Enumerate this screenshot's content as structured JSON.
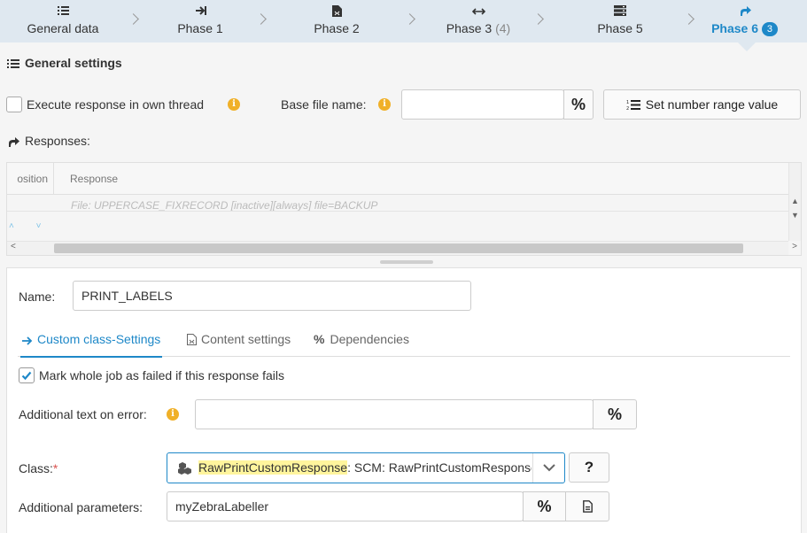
{
  "steps": [
    {
      "label": "General data",
      "icon": "list-icon"
    },
    {
      "label": "Phase 1",
      "icon": "arrow-to-right-icon"
    },
    {
      "label": "Phase 2",
      "icon": "file-code-icon"
    },
    {
      "label": "Phase 3",
      "count": "(4)",
      "icon": "arrows-horizontal-icon"
    },
    {
      "label": "Phase 5",
      "icon": "server-icon"
    },
    {
      "label": "Phase 6",
      "badge": "3",
      "icon": "share-arrow-icon",
      "active": true
    }
  ],
  "general": {
    "title": "General settings",
    "execute_label": "Execute response in own thread",
    "base_file_label": "Base file name:",
    "base_file_value": "",
    "pct_symbol": "%",
    "set_number_range_label": "Set number range value",
    "responses_label": "Responses:"
  },
  "grid": {
    "columns": [
      "osition",
      "Response"
    ],
    "rows": [
      {
        "response": "File: UPPERCASE_FIXRECORD [inactive][always] file=BACKUP"
      }
    ]
  },
  "detail": {
    "name_label": "Name:",
    "name_value": "PRINT_LABELS",
    "tabs": [
      {
        "label_main": "Custom class",
        "label_suffix": "-Settings",
        "active": true
      },
      {
        "label": "Content settings"
      },
      {
        "label": "Dependencies"
      }
    ],
    "mark_failed_label": "Mark whole job as failed if this response fails",
    "mark_failed_checked": true,
    "additional_text_label": "Additional text on error:",
    "additional_text_value": "",
    "class_label": "Class:",
    "class_required": "*",
    "class_highlight": "RawPrintCustomResponse",
    "class_rest": ": SCM: RawPrintCustomResponse",
    "help_symbol": "?",
    "additional_params_label": "Additional parameters:",
    "additional_params_value": "myZebraLabeller"
  },
  "colors": {
    "accent": "#1e88c8",
    "steps_bg": "#dfe8f0",
    "info": "#f0b028",
    "highlight": "#fff59d"
  }
}
